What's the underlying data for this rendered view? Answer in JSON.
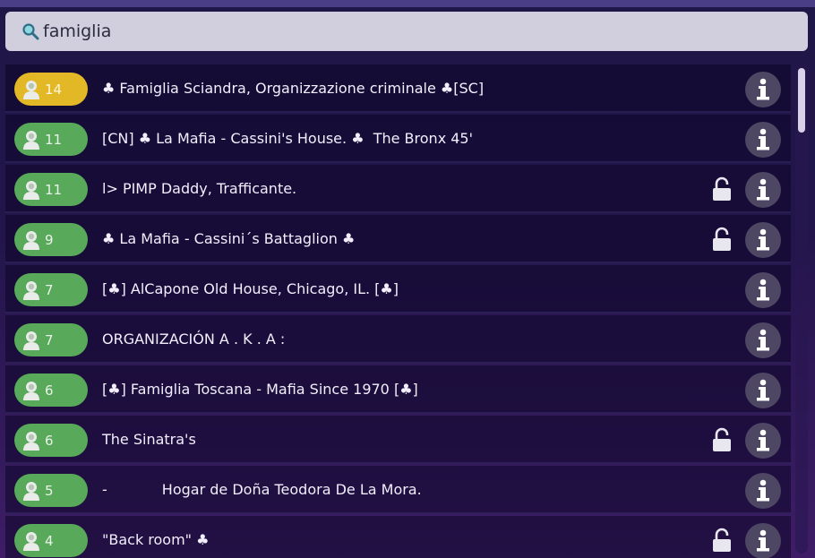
{
  "search": {
    "query": "famiglia",
    "icon": "search-icon"
  },
  "rooms": [
    {
      "count": "14",
      "name": "♣ Famiglia Sciandra, Organizzazione criminale ♣[SC]",
      "locked": false,
      "highlight": true
    },
    {
      "count": "11",
      "name": "[CN] ♣ La Mafia - Cassini's House. ♣  The Bronx 45'",
      "locked": false,
      "highlight": false
    },
    {
      "count": "11",
      "name": "l> PIMP Daddy, Trafficante.",
      "locked": true,
      "highlight": false
    },
    {
      "count": "9",
      "name": "♣ La Mafia - Cassini´s Battaglion ♣",
      "locked": true,
      "highlight": false
    },
    {
      "count": "7",
      "name": "[♣] AlCapone Old House, Chicago, IL. [♣]",
      "locked": false,
      "highlight": false
    },
    {
      "count": "7",
      "name": "ORGANIZACIÓN A . K . A :",
      "locked": false,
      "highlight": false
    },
    {
      "count": "6",
      "name": "[♣] Famiglia Toscana - Mafia Since 1970 [♣]",
      "locked": false,
      "highlight": false
    },
    {
      "count": "6",
      "name": "The Sinatra's",
      "locked": true,
      "highlight": false
    },
    {
      "count": "5",
      "name": "-            Hogar de Doña Teodora De La Mora.",
      "locked": false,
      "highlight": false
    },
    {
      "count": "4",
      "name": "\"Back room\" ♣",
      "locked": true,
      "highlight": false
    }
  ],
  "colors": {
    "badge_green": "#58a95a",
    "badge_gold": "#e3b826",
    "info_button": "#4d4763",
    "search_bg": "#d1cedd"
  }
}
